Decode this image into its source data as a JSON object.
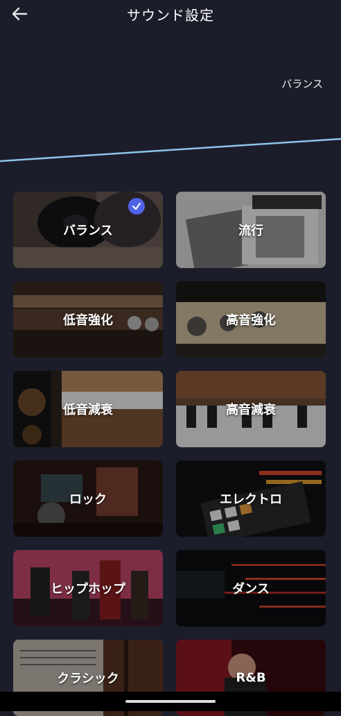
{
  "header": {
    "title": "サウンド設定",
    "back_icon": "arrow-left-icon"
  },
  "equalizer": {
    "selected_preset_label": "バランス",
    "line_color": "#8ec5ee"
  },
  "presets": [
    {
      "label": "バランス",
      "selected": true
    },
    {
      "label": "流行",
      "selected": false
    },
    {
      "label": "低音強化",
      "selected": false
    },
    {
      "label": "高音強化",
      "selected": false
    },
    {
      "label": "低音減衰",
      "selected": false
    },
    {
      "label": "高音減衰",
      "selected": false
    },
    {
      "label": "ロック",
      "selected": false
    },
    {
      "label": "エレクトロ",
      "selected": false
    },
    {
      "label": "ヒップホップ",
      "selected": false
    },
    {
      "label": "ダンス",
      "selected": false
    },
    {
      "label": "クラシック",
      "selected": false
    },
    {
      "label": "R&B",
      "selected": false
    }
  ],
  "colors": {
    "background": "#1c1d2b",
    "accent": "#4f63e8"
  }
}
